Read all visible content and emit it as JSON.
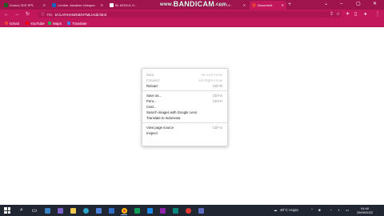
{
  "tabs": [
    {
      "label": "Kursus 3DS RPL",
      "color": "#1b5e20"
    },
    {
      "label": "Lembar Jawaban Ulangan",
      "color": "#1565c0"
    },
    {
      "label": "BL MODUL D...",
      "color": "#ffffff"
    },
    {
      "label": "VAR, LE...",
      "color": "#ffffff"
    },
    {
      "label": "Document",
      "color": "#e53935",
      "active": true
    }
  ],
  "watermark": {
    "prefix": "www.",
    "brand": "BANDICAM",
    "suffix": ".com"
  },
  "toolbar": {
    "back_icon": "←",
    "forward_icon": "→",
    "reload_icon": "↻",
    "address_label": "File",
    "address_value": "D:/LATIHAN/KB/HTML/Add.html"
  },
  "bookmarks": [
    {
      "label": "Gmail",
      "color": "#ea4335"
    },
    {
      "label": "YouTube",
      "color": "#ff0000"
    },
    {
      "label": "Maps",
      "color": "#34a853"
    },
    {
      "label": "Translate",
      "color": "#4285f4"
    }
  ],
  "context_menu": {
    "items": [
      {
        "label": "Back",
        "shortcut": "Alt+Left Arrow",
        "disabled": true
      },
      {
        "label": "Forward",
        "shortcut": "Alt+Right Arrow",
        "disabled": true
      },
      {
        "label": "Reload",
        "shortcut": "Ctrl+R",
        "disabled": false
      },
      {
        "separator": true
      },
      {
        "label": "Save as...",
        "shortcut": "Ctrl+S",
        "disabled": false
      },
      {
        "label": "Print...",
        "shortcut": "Ctrl+P",
        "disabled": false
      },
      {
        "label": "Cast...",
        "shortcut": "",
        "disabled": false
      },
      {
        "label": "Search images with Google Lens",
        "shortcut": "",
        "disabled": false
      },
      {
        "label": "Translate to Indonesia",
        "shortcut": "",
        "disabled": false
      },
      {
        "separator": true
      },
      {
        "label": "View page source",
        "shortcut": "Ctrl+U",
        "disabled": false
      },
      {
        "label": "Inspect",
        "shortcut": "",
        "disabled": false
      }
    ]
  },
  "taskbar": {
    "weather": "30°C Hujan",
    "time": "04:40",
    "date": "29/09/2022"
  }
}
